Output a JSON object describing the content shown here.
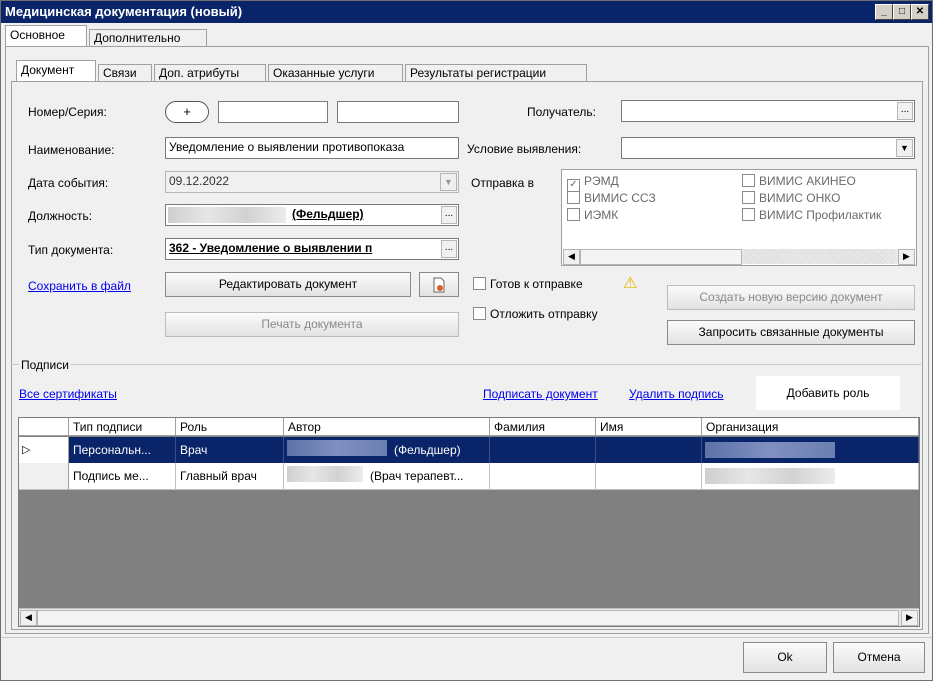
{
  "window": {
    "title": "Медицинская документация (новый)"
  },
  "outer_tabs": [
    {
      "label": "Основное"
    },
    {
      "label": "Дополнительно"
    }
  ],
  "inner_tabs": [
    {
      "label": "Документ"
    },
    {
      "label": "Связи"
    },
    {
      "label": "Доп. атрибуты"
    },
    {
      "label": "Оказанные услуги"
    },
    {
      "label": "Результаты регистрации"
    }
  ],
  "form": {
    "number_label": "Номер/Серия:",
    "plus_label": "+",
    "number_value": "",
    "series_value": "",
    "name_label": "Наименование:",
    "name_value": "Уведомление о выявлении противопоказа",
    "date_label": "Дата события:",
    "date_value": "09.12.2022",
    "position_label": "Должность:",
    "position_value": "(Фельдшер)",
    "doctype_label": "Тип документа:",
    "doctype_value": "362 - Уведомление о выявлении п",
    "recipient_label": "Получатель:",
    "recipient_value": "",
    "condition_label": "Условие выявления:",
    "condition_value": "",
    "send_label": "Отправка в",
    "ellipsis": "..."
  },
  "send_options": [
    {
      "label": "РЭМД",
      "checked": true
    },
    {
      "label": "ВИМИС АКИНЕО",
      "checked": false
    },
    {
      "label": "ВИМИС ССЗ",
      "checked": false
    },
    {
      "label": "ВИМИС ОНКО",
      "checked": false
    },
    {
      "label": "ИЭМК",
      "checked": false
    },
    {
      "label": "ВИМИС Профилактик",
      "checked": false
    }
  ],
  "actions": {
    "save_to_file": "Сохранить в файл",
    "edit_document": "Редактировать документ",
    "print_document": "Печать документа",
    "ready_to_send": "Готов к отправке",
    "postpone_send": "Отложить отправку",
    "create_new_version": "Создать новую версию документ",
    "request_related": "Запросить связанные документы"
  },
  "signatures": {
    "group_label": "Подписи",
    "all_certificates": "Все сертификаты",
    "sign_document": "Подписать документ",
    "delete_signature": "Удалить подпись",
    "add_role": "Добавить роль",
    "columns": [
      "Тип подписи",
      "Роль",
      "Автор",
      "Фамилия",
      "Имя",
      "Организация"
    ],
    "rows": [
      {
        "type": "Персональн...",
        "role": "Врач",
        "author": "(Фельдшер)",
        "selected": true
      },
      {
        "type": "Подпись ме...",
        "role": "Главный врач",
        "author": "(Врач терапевт...",
        "selected": false
      }
    ]
  },
  "footer": {
    "ok": "Ok",
    "cancel": "Отмена"
  },
  "colors": {
    "titlebar": "#0a246a",
    "selection": "#0a246a",
    "link": "#0000ee",
    "grid_bg": "#808080"
  }
}
